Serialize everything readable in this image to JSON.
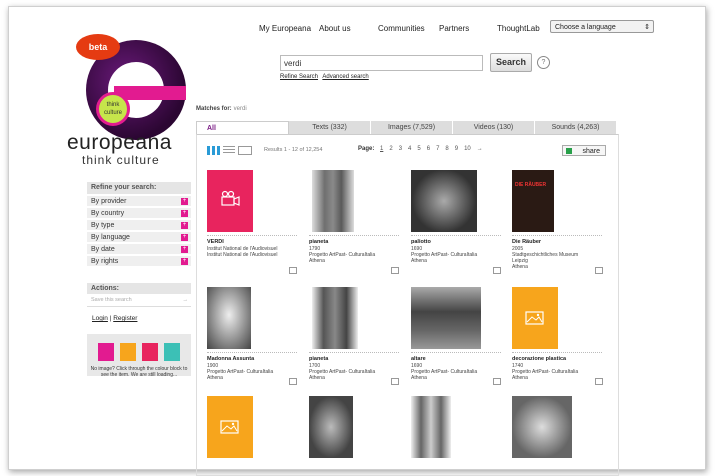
{
  "brand": {
    "badge": "beta",
    "bubble": "think culture",
    "name": "europeana",
    "tagline": "think culture"
  },
  "nav": {
    "items": [
      "My Europeana",
      "About us",
      "Communities",
      "Partners",
      "ThoughtLab"
    ],
    "language_select": "Choose a language"
  },
  "search": {
    "query": "verdi",
    "button": "Search",
    "help": "?",
    "refine_link": "Refine Search",
    "advanced_link": "Advanced search"
  },
  "matches": {
    "label": "Matches for:",
    "term": "verdi"
  },
  "tabs": [
    "All",
    "Texts (332)",
    "Images (7,529)",
    "Videos (130)",
    "Sounds (4,263)"
  ],
  "results": {
    "count_text": "Results 1 - 12 of 12,254",
    "page_label": "Page:",
    "pages": [
      "1",
      "2",
      "3",
      "4",
      "5",
      "6",
      "7",
      "8",
      "9",
      "10",
      "→"
    ],
    "share": "share"
  },
  "items": [
    {
      "title": "VERDI",
      "lines": [
        "Institut National de l'Audiovisuel",
        "Institut National de l'Audiovisuel"
      ],
      "kind": "video-icon"
    },
    {
      "title": "pianeta",
      "lines": [
        "1790",
        "Progetto ArtPast- CulturaItalia",
        "Athena"
      ],
      "kind": "photo"
    },
    {
      "title": "paliotto",
      "lines": [
        "1690",
        "Progetto ArtPast- CulturaItalia",
        "Athena"
      ],
      "kind": "photo"
    },
    {
      "title": "Die Räuber",
      "lines": [
        "2005",
        "Stadtgeschichtliches Museum",
        "Leipzig",
        "Athena"
      ],
      "kind": "photo"
    },
    {
      "title": "Madonna Assunta",
      "lines": [
        "1900",
        "Progetto ArtPast- CulturaItalia",
        "Athena"
      ],
      "kind": "photo"
    },
    {
      "title": "pianeta",
      "lines": [
        "1700",
        "Progetto ArtPast- CulturaItalia",
        "Athena"
      ],
      "kind": "photo"
    },
    {
      "title": "altare",
      "lines": [
        "1690",
        "Progetto ArtPast- CulturaItalia",
        "Athena"
      ],
      "kind": "photo"
    },
    {
      "title": "decorazione plastica",
      "lines": [
        "1740",
        "Progetto ArtPast- CulturaItalia",
        "Athena"
      ],
      "kind": "image-icon"
    },
    {
      "title": "",
      "lines": [],
      "kind": "image-icon"
    },
    {
      "title": "",
      "lines": [],
      "kind": "photo"
    },
    {
      "title": "",
      "lines": [],
      "kind": "photo"
    },
    {
      "title": "",
      "lines": [],
      "kind": "photo"
    }
  ],
  "die_rauber_poster": "DIE RÄUBER",
  "sidebar": {
    "heading": "Refine your search:",
    "facets": [
      "By provider",
      "By country",
      "By type",
      "By language",
      "By date",
      "By rights"
    ],
    "plus": "+",
    "actions_heading": "Actions:",
    "save_search": "Save this search",
    "save_arrow": "→",
    "login": "Login",
    "separator": "|",
    "register": "Register",
    "noimage_text": "No image? Click through the colour block to see the item. We are still loading..."
  },
  "colors": {
    "brand_purple": "#7b1d86",
    "brand_pink": "#e21b90",
    "image_orange": "#f7a51c",
    "accent_blue": "#2a9bd6",
    "share_green": "#28a04a"
  }
}
